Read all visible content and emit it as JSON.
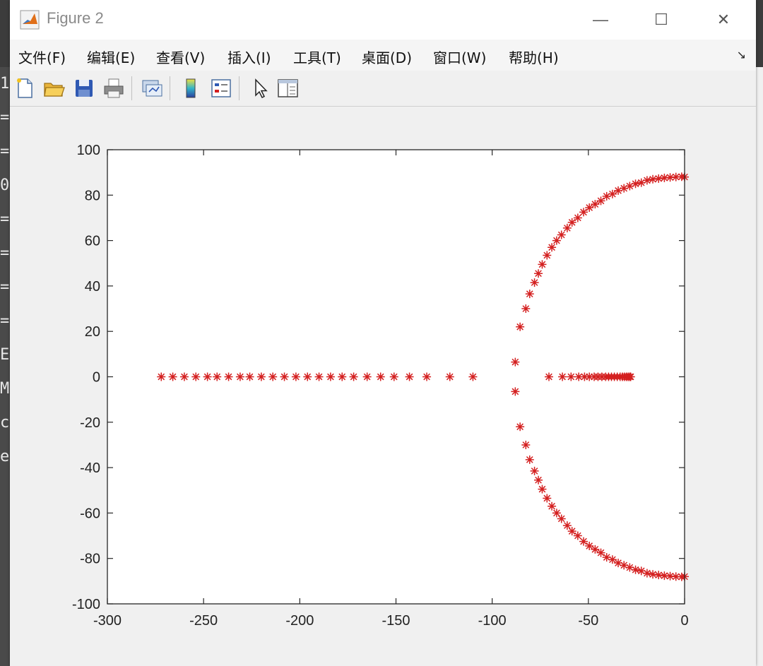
{
  "window": {
    "title": "Figure 2",
    "minimize_glyph": "—",
    "maximize_glyph": "☐",
    "close_glyph": "✕"
  },
  "menu": {
    "items": [
      {
        "label": "文件(F)"
      },
      {
        "label": "编辑(E)"
      },
      {
        "label": "查看(V)"
      },
      {
        "label": "插入(I)"
      },
      {
        "label": "工具(T)"
      },
      {
        "label": "桌面(D)"
      },
      {
        "label": "窗口(W)"
      },
      {
        "label": "帮助(H)"
      }
    ],
    "dock_arrow": "↘"
  },
  "toolbar": {
    "buttons": [
      {
        "icon": "new-figure-icon"
      },
      {
        "icon": "open-file-icon"
      },
      {
        "icon": "save-icon"
      },
      {
        "icon": "print-icon"
      },
      {
        "icon": "link-plot-icon"
      },
      {
        "icon": "colorbar-icon"
      },
      {
        "icon": "legend-icon"
      },
      {
        "icon": "edit-plot-arrow-icon"
      },
      {
        "icon": "property-inspector-icon"
      }
    ]
  },
  "background_window": {
    "glyphs": [
      "1",
      "=",
      "=",
      "0",
      "=",
      "=",
      "=",
      "=",
      "E",
      "M",
      "c",
      "e"
    ]
  },
  "colors": {
    "marker": "#d42020",
    "axes": "#262626",
    "plot_bg": "#ffffff",
    "figure_bg": "#f0f0f0"
  },
  "chart_data": {
    "type": "scatter",
    "marker": "*",
    "title": "",
    "xlabel": "",
    "ylabel": "",
    "xlim": [
      -300,
      0
    ],
    "ylim": [
      -100,
      100
    ],
    "xticks": [
      -300,
      -250,
      -200,
      -150,
      -100,
      -50,
      0
    ],
    "yticks": [
      -100,
      -80,
      -60,
      -40,
      -20,
      0,
      20,
      40,
      60,
      80,
      100
    ],
    "xtick_labels": [
      "-300",
      "-250",
      "-200",
      "-150",
      "-100",
      "-50",
      "0"
    ],
    "ytick_labels": [
      "-100",
      "-80",
      "-60",
      "-40",
      "-20",
      "0",
      "20",
      "40",
      "60",
      "80",
      "100"
    ],
    "grid": false,
    "series": [
      {
        "values": [
          [
            -272,
            0
          ],
          [
            -266,
            0
          ],
          [
            -260,
            0
          ],
          [
            -254,
            0
          ],
          [
            -248,
            0
          ],
          [
            -243,
            0
          ],
          [
            -237,
            0
          ],
          [
            -231,
            0
          ],
          [
            -226,
            0
          ],
          [
            -220,
            0
          ],
          [
            -214,
            0
          ],
          [
            -208,
            0
          ],
          [
            -202,
            0
          ],
          [
            -196,
            0
          ],
          [
            -190,
            0
          ],
          [
            -184,
            0
          ],
          [
            -178,
            0
          ],
          [
            -172,
            0
          ],
          [
            -165,
            0
          ],
          [
            -158,
            0
          ],
          [
            -151,
            0
          ],
          [
            -143,
            0
          ],
          [
            -134,
            0
          ],
          [
            -122,
            0
          ],
          [
            -110,
            0
          ],
          [
            -70.5,
            0
          ],
          [
            -63.5,
            0
          ],
          [
            -59,
            0
          ],
          [
            -55,
            0
          ],
          [
            -52,
            0
          ],
          [
            -49.5,
            0
          ],
          [
            -47,
            0
          ],
          [
            -45,
            0
          ],
          [
            -43,
            0
          ],
          [
            -41,
            0
          ],
          [
            -39.5,
            0
          ],
          [
            -38,
            0
          ],
          [
            -36.5,
            0
          ],
          [
            -35,
            0
          ],
          [
            -33.5,
            0
          ],
          [
            -32.3,
            0
          ],
          [
            -31.2,
            0
          ],
          [
            -30.2,
            0
          ],
          [
            -29.3,
            0
          ],
          [
            -28.5,
            0
          ],
          [
            -28,
            0
          ],
          [
            -88,
            6.5
          ],
          [
            -88,
            -6.5
          ],
          [
            -85.5,
            22
          ],
          [
            -85.5,
            -22
          ],
          [
            -82.5,
            30
          ],
          [
            -82.5,
            -30
          ],
          [
            -80.5,
            36.5
          ],
          [
            -80.5,
            -36.5
          ],
          [
            -78,
            41.5
          ],
          [
            -78,
            -41.5
          ],
          [
            -76,
            45.5
          ],
          [
            -76,
            -45.5
          ],
          [
            -74,
            49.5
          ],
          [
            -74,
            -49.5
          ],
          [
            -71.5,
            53.5
          ],
          [
            -71.5,
            -53.5
          ],
          [
            -69,
            57
          ],
          [
            -69,
            -57
          ],
          [
            -66.5,
            60
          ],
          [
            -66.5,
            -60
          ],
          [
            -64,
            62.5
          ],
          [
            -64,
            -62.5
          ],
          [
            -61,
            65.5
          ],
          [
            -61,
            -65.5
          ],
          [
            -58.5,
            68
          ],
          [
            -58.5,
            -68
          ],
          [
            -55.5,
            70
          ],
          [
            -55.5,
            -70
          ],
          [
            -52.5,
            72.5
          ],
          [
            -52.5,
            -72.5
          ],
          [
            -49.5,
            74.5
          ],
          [
            -49.5,
            -74.5
          ],
          [
            -46.5,
            76
          ],
          [
            -46.5,
            -76
          ],
          [
            -43.5,
            77.5
          ],
          [
            -43.5,
            -77.5
          ],
          [
            -40.5,
            79.5
          ],
          [
            -40.5,
            -79.5
          ],
          [
            -37.5,
            80.5
          ],
          [
            -37.5,
            -80.5
          ],
          [
            -34.5,
            82
          ],
          [
            -34.5,
            -82
          ],
          [
            -31.5,
            83
          ],
          [
            -31.5,
            -83
          ],
          [
            -28.5,
            84
          ],
          [
            -28.5,
            -84
          ],
          [
            -25.5,
            85
          ],
          [
            -25.5,
            -85
          ],
          [
            -22.5,
            85.5
          ],
          [
            -22.5,
            -85.5
          ],
          [
            -19.5,
            86.5
          ],
          [
            -19.5,
            -86.5
          ],
          [
            -16.5,
            87
          ],
          [
            -16.5,
            -87
          ],
          [
            -13.5,
            87.3
          ],
          [
            -13.5,
            -87.3
          ],
          [
            -10.5,
            87.6
          ],
          [
            -10.5,
            -87.6
          ],
          [
            -7.5,
            87.8
          ],
          [
            -7.5,
            -87.8
          ],
          [
            -4.5,
            88
          ],
          [
            -4.5,
            -88
          ],
          [
            -1.5,
            88.1
          ],
          [
            -1.5,
            -88.1
          ],
          [
            0,
            88
          ],
          [
            0,
            -88
          ]
        ]
      }
    ]
  }
}
